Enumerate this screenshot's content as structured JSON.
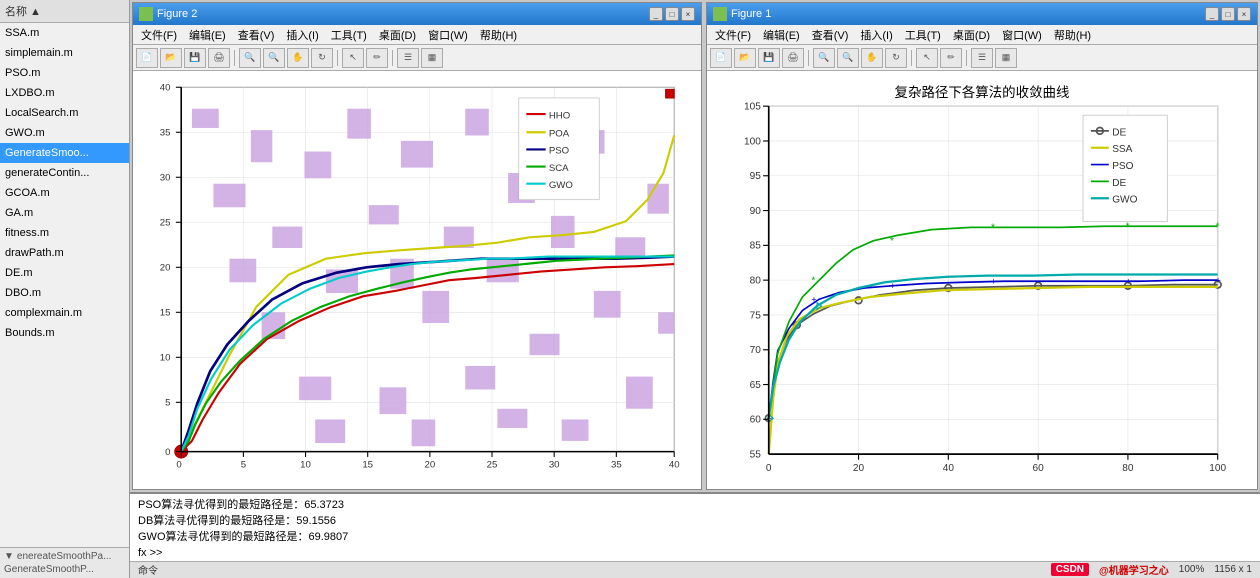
{
  "sidebar": {
    "header": "名称 ▲",
    "items": [
      {
        "label": "SSA.m",
        "line": "13",
        "selected": false
      },
      {
        "label": "simplemain.m",
        "line": "13",
        "selected": false
      },
      {
        "label": "PSO.m",
        "line": "13",
        "selected": false
      },
      {
        "label": "LXDBO.m",
        "line": "13",
        "selected": false
      },
      {
        "label": "LocalSearch.m",
        "line": "13",
        "selected": false
      },
      {
        "label": "GWO.m",
        "line": "13",
        "selected": false
      },
      {
        "label": "GenerateSmoo...",
        "line": "13",
        "selected": true,
        "current": true
      },
      {
        "label": "generateContin...",
        "line": "14",
        "selected": false
      },
      {
        "label": "GCOA.m",
        "line": "14",
        "selected": false
      },
      {
        "label": "GA.m",
        "line": "14",
        "selected": false
      },
      {
        "label": "fitness.m",
        "line": "14",
        "selected": false
      },
      {
        "label": "drawPath.m",
        "line": "14",
        "selected": false
      },
      {
        "label": "DE.m",
        "line": "14",
        "selected": false
      },
      {
        "label": "DBO.m",
        "line": "14",
        "selected": false
      },
      {
        "label": "complexmain.m",
        "line": "14",
        "selected": false
      },
      {
        "label": "Bounds.m",
        "line": "15",
        "selected": false
      }
    ],
    "footer1": "enereateSmoothPa...",
    "footer2": "GenerateSmoothP..."
  },
  "figure2": {
    "title": "Figure 2",
    "menu": [
      "文件(F)",
      "编辑(E)",
      "查看(V)",
      "插入(I)",
      "工具(T)",
      "桌面(D)",
      "窗口(W)",
      "帮助(H)"
    ],
    "legend": {
      "items": [
        {
          "label": "HHO",
          "color": "#cc0000"
        },
        {
          "label": "POA",
          "color": "#cccc00"
        },
        {
          "label": "PSO",
          "color": "#000080"
        },
        {
          "label": "SCA",
          "color": "#00aa00"
        },
        {
          "label": "GWO",
          "color": "#00cccc"
        }
      ]
    },
    "xaxis": {
      "min": 0,
      "max": 40,
      "ticks": [
        0,
        5,
        10,
        15,
        20,
        25,
        30,
        35,
        40
      ]
    },
    "yaxis": {
      "min": 0,
      "max": 40,
      "ticks": [
        0,
        5,
        10,
        15,
        20,
        25,
        30,
        35,
        40
      ]
    }
  },
  "figure1": {
    "title": "Figure 1",
    "menu": [
      "文件(F)",
      "编辑(E)",
      "查看(V)",
      "插入(I)",
      "工具(T)",
      "桌面(D)",
      "窗口(W)",
      "帮助(H)"
    ],
    "chart_title": "复杂路径下各算法的收敛曲线",
    "legend": {
      "items": [
        {
          "label": "DE",
          "color": "#555555",
          "marker": "circle"
        },
        {
          "label": "SSA",
          "color": "#cccc00",
          "marker": "square"
        },
        {
          "label": "PSO",
          "color": "#0000cc",
          "marker": "plus"
        },
        {
          "label": "DE",
          "color": "#00aa00",
          "marker": "asterisk"
        },
        {
          "label": "GWO",
          "color": "#00cccc",
          "marker": "triangle"
        }
      ]
    },
    "xaxis": {
      "min": 0,
      "max": 100,
      "ticks": [
        0,
        20,
        40,
        60,
        80,
        100
      ]
    },
    "yaxis": {
      "min": 55,
      "max": 105,
      "ticks": [
        55,
        60,
        65,
        70,
        75,
        80,
        85,
        90,
        95,
        100,
        105
      ]
    }
  },
  "console": {
    "lines": [
      "PSO算法寻优得到的最短路径是：65.3723",
      "DB算法寻优得到的最短路径是：59.1556",
      "GWO算法寻优得到的最短路径是：69.9807"
    ],
    "prompt": "fx >>"
  },
  "bottom": {
    "status1": "命令",
    "csdn_text": "CSDN@机器学习之心",
    "zoom": "100%",
    "size": "1156 x 1"
  }
}
